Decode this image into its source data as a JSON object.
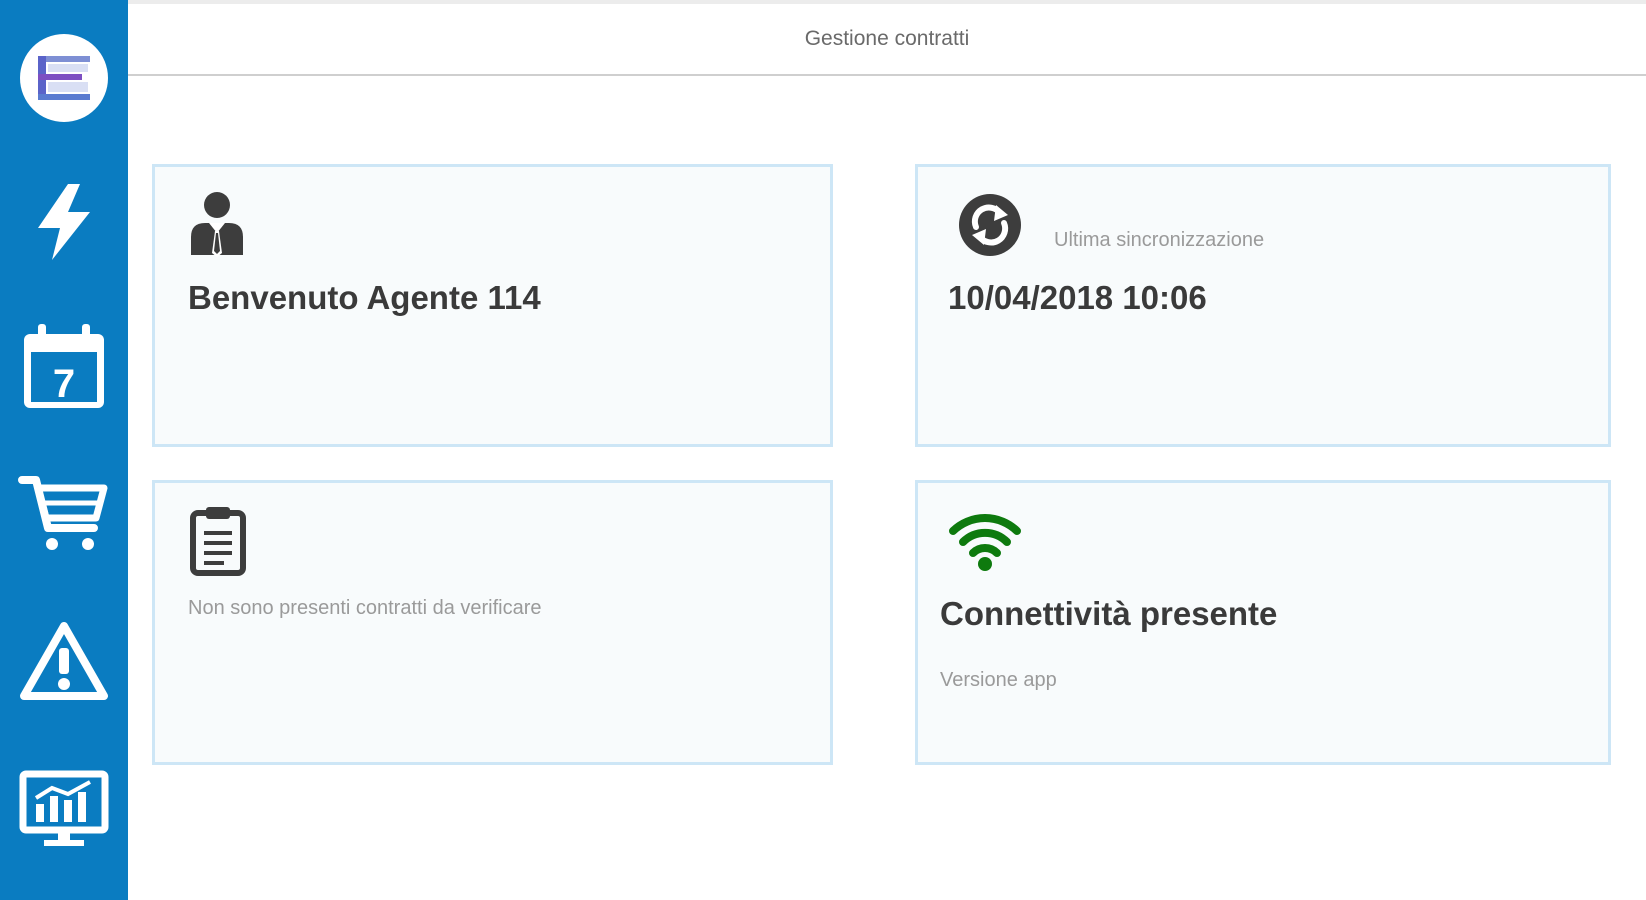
{
  "header": {
    "title": "Gestione contratti"
  },
  "sidebar": {
    "items": [
      {
        "name": "logo",
        "icon": "app-logo-icon"
      },
      {
        "name": "quick-actions",
        "icon": "lightning-icon"
      },
      {
        "name": "calendar",
        "icon": "calendar-icon",
        "day": "7"
      },
      {
        "name": "cart",
        "icon": "shopping-cart-icon"
      },
      {
        "name": "alerts",
        "icon": "warning-icon"
      },
      {
        "name": "reports",
        "icon": "monitor-chart-icon"
      }
    ]
  },
  "cards": {
    "welcome": {
      "icon": "agent-icon",
      "text": "Benvenuto Agente 114"
    },
    "sync": {
      "icon": "sync-icon",
      "label": "Ultima sincronizzazione",
      "datetime": "10/04/2018 10:06"
    },
    "contracts": {
      "icon": "clipboard-icon",
      "message": "Non sono presenti contratti da verificare"
    },
    "connectivity": {
      "icon": "wifi-icon",
      "status": "Connettività presente",
      "version_label": "Versione app"
    }
  },
  "colors": {
    "sidebar": "#0a7cc1",
    "card_border": "#cde6f6",
    "card_background": "#f8fbfc",
    "wifi": "#0e7a0e",
    "icon_dark": "#3d3d3d"
  }
}
